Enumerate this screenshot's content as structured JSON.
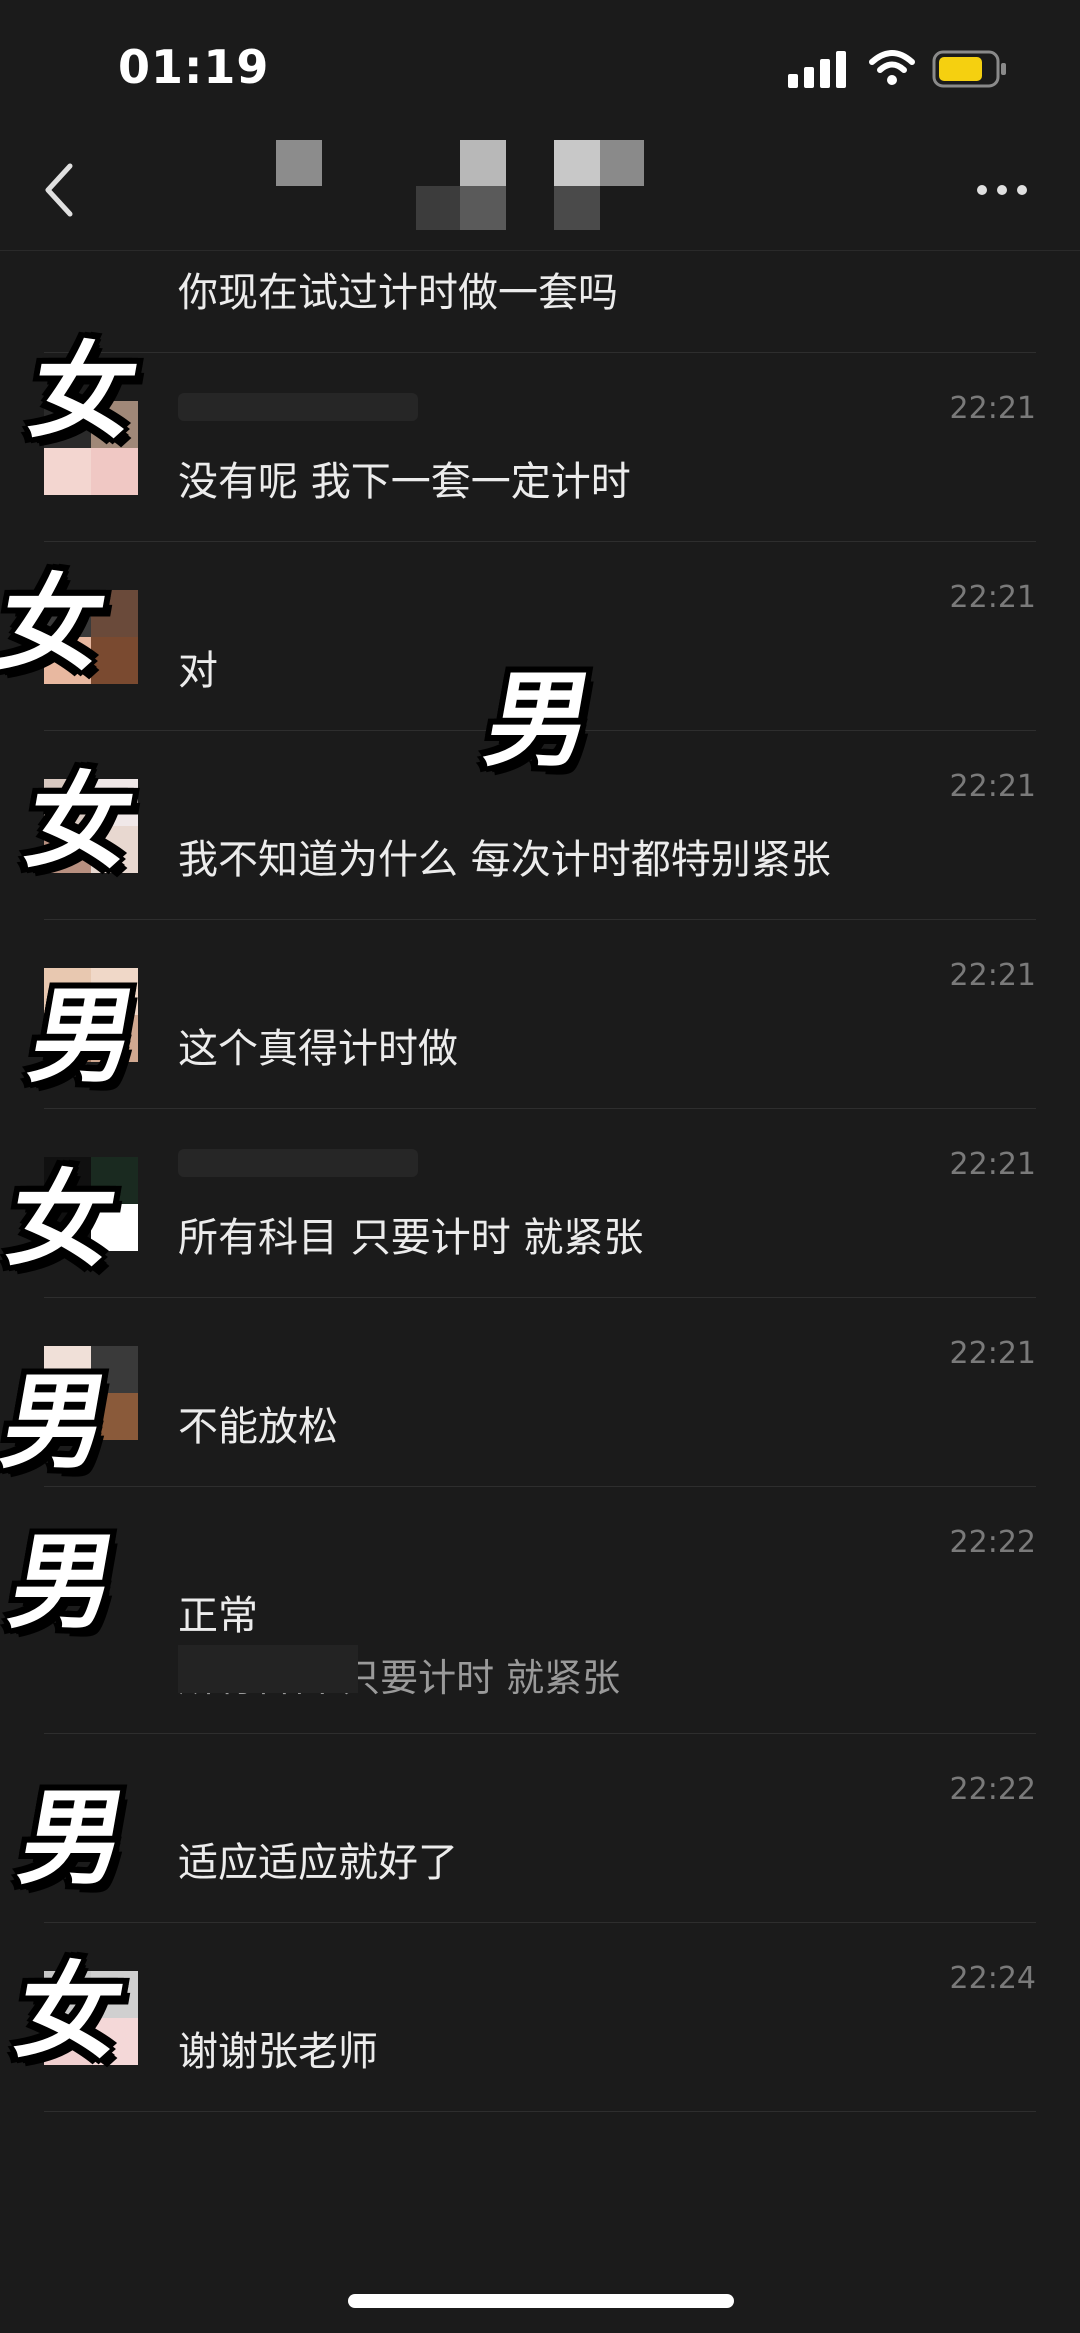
{
  "status_bar": {
    "time": "01:19",
    "battery_color": "#f5d010"
  },
  "nav": {
    "back_icon": "chevron-left-icon",
    "more_icon": "more-dots-icon"
  },
  "messages": [
    {
      "time": "",
      "text": "你现在试过计时做一套吗",
      "sticker": ""
    },
    {
      "time": "22:21",
      "text": "没有呢 我下一套一定计时",
      "sticker": "女"
    },
    {
      "time": "22:21",
      "text": "对",
      "sticker": "女"
    },
    {
      "time": "22:21",
      "text": "我不知道为什么 每次计时都特别紧张",
      "sticker": "女"
    },
    {
      "time": "22:21",
      "text": "这个真得计时做",
      "sticker": "男"
    },
    {
      "time": "22:21",
      "text": "所有科目 只要计时 就紧张",
      "sticker": "女"
    },
    {
      "time": "22:21",
      "text": "不能放松",
      "sticker": "男"
    },
    {
      "time": "22:22",
      "text": "正常",
      "quote": "所有科目 只要计时 就紧张",
      "sticker": "男"
    },
    {
      "time": "22:22",
      "text": "适应适应就好了",
      "sticker": "男"
    },
    {
      "time": "22:24",
      "text": "谢谢张老师",
      "sticker": "女"
    }
  ],
  "floating_sticker": "男"
}
